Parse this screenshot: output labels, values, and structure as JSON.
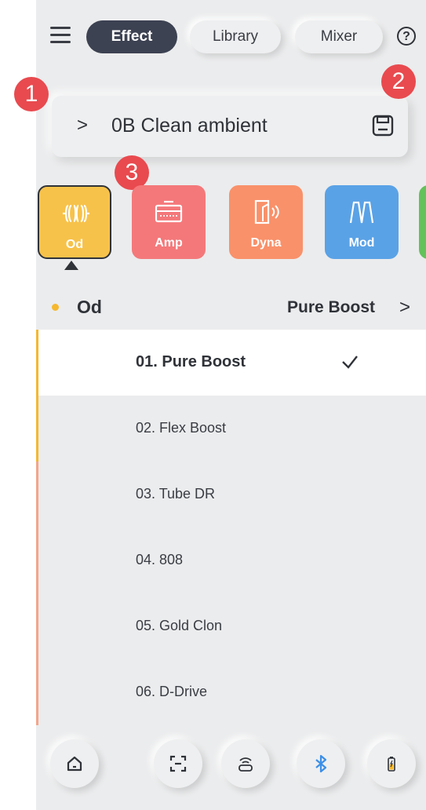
{
  "header": {
    "tabs": [
      {
        "label": "Effect",
        "active": true
      },
      {
        "label": "Library",
        "active": false
      },
      {
        "label": "Mixer",
        "active": false
      }
    ],
    "help_label": "?"
  },
  "preset": {
    "chevron": ">",
    "name": "0B Clean ambient"
  },
  "callouts": [
    "1",
    "2",
    "3"
  ],
  "effect_blocks": [
    {
      "label": "Od",
      "color": "#f7c24a",
      "icon": "od-icon",
      "selected": true
    },
    {
      "label": "Amp",
      "color": "#f4787a",
      "icon": "amp-icon",
      "selected": false
    },
    {
      "label": "Dyna",
      "color": "#f9916a",
      "icon": "dyna-icon",
      "selected": false
    },
    {
      "label": "Mod",
      "color": "#5aa2e6",
      "icon": "mod-icon",
      "selected": false
    },
    {
      "label": "",
      "color": "#63c25a",
      "icon": "",
      "selected": false
    }
  ],
  "section": {
    "title": "Od",
    "current": "Pure Boost",
    "chevron": ">"
  },
  "effects": [
    {
      "label": "01. Pure Boost",
      "selected": true
    },
    {
      "label": "02. Flex Boost",
      "selected": false
    },
    {
      "label": "03. Tube DR",
      "selected": false
    },
    {
      "label": "04. 808",
      "selected": false
    },
    {
      "label": "05. Gold Clon",
      "selected": false
    },
    {
      "label": "06. D-Drive",
      "selected": false
    }
  ],
  "bottom_nav": [
    {
      "icon": "home-icon"
    },
    {
      "icon": "scan-icon"
    },
    {
      "icon": "wireless-icon"
    },
    {
      "icon": "bluetooth-icon"
    },
    {
      "icon": "battery-icon"
    }
  ],
  "colors": {
    "background": "#ebeced",
    "active_tab": "#3d4252",
    "callout": "#e84a4f",
    "od_accent": "#f5b82e",
    "amp_accent": "#f4a58a",
    "bluetooth": "#3b8fe8"
  }
}
